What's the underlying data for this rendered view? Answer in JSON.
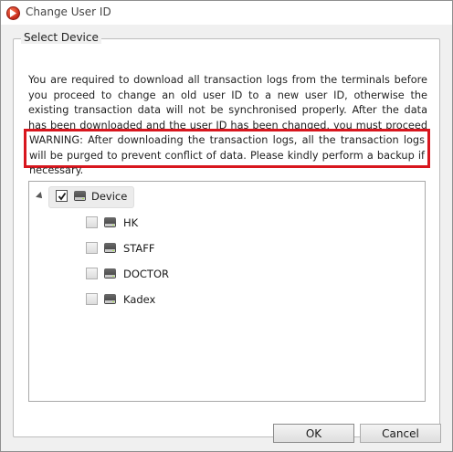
{
  "window": {
    "title": "Change User ID",
    "app_icon": "app-logo-icon"
  },
  "group": {
    "legend": "Select Device"
  },
  "info": {
    "text": "You are required to download all transaction logs from the terminals before you proceed to change an old user ID to a new user ID, otherwise the existing transaction data will not be synchronised properly. After the data has been downloaded and the user ID has been changed, you must proceed to update the new ID to the terminals."
  },
  "warning": {
    "text": "WARNING: After downloading the transaction logs, all the transaction logs will be purged to prevent conflict of data. Please kindly perform a backup if necessary.",
    "highlight_color": "#d8161e"
  },
  "tree": {
    "root": {
      "label": "Device",
      "checked": true,
      "expanded": true,
      "icon": "drive-icon"
    },
    "children": [
      {
        "label": "HK",
        "checked": false,
        "icon": "drive-icon"
      },
      {
        "label": "STAFF",
        "checked": false,
        "icon": "drive-icon"
      },
      {
        "label": "DOCTOR",
        "checked": false,
        "icon": "drive-icon"
      },
      {
        "label": "Kadex",
        "checked": false,
        "icon": "drive-icon"
      }
    ]
  },
  "buttons": {
    "ok_label": "OK",
    "cancel_label": "Cancel"
  }
}
